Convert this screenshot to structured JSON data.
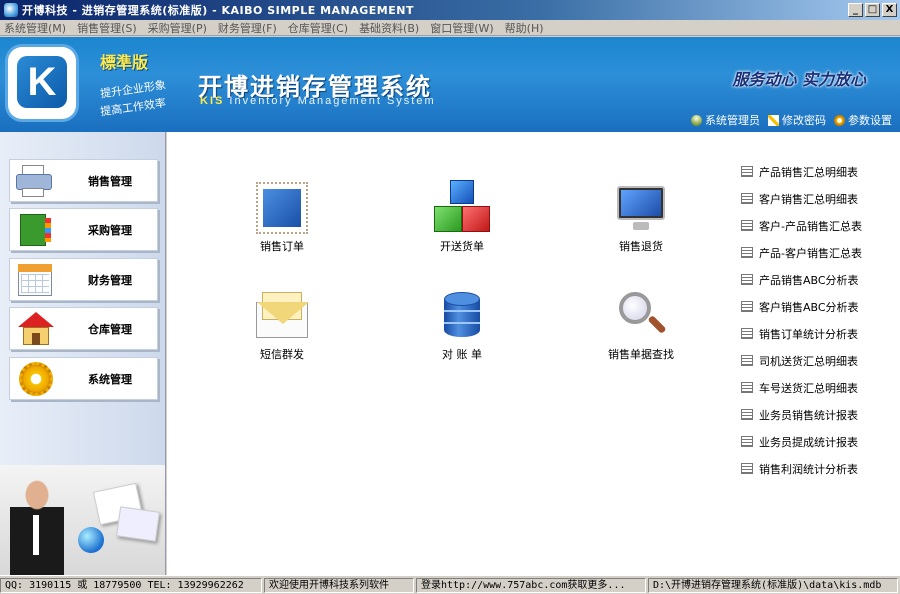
{
  "window": {
    "title": "开博科技 - 进销存管理系统(标准版) - KAIBO SIMPLE MANAGEMENT",
    "minimize": "_",
    "maximize": "□",
    "close": "X"
  },
  "menu": [
    "系统管理(M)",
    "销售管理(S)",
    "采购管理(P)",
    "财务管理(F)",
    "仓库管理(C)",
    "基础资料(B)",
    "窗口管理(W)",
    "帮助(H)"
  ],
  "banner": {
    "logo_letter": "K",
    "edition": "標準版",
    "slogan_line1": "提升企业形象",
    "slogan_line2": "提高工作效率",
    "title": "开博进销存管理系统",
    "subtitle_kis": "KIS",
    "subtitle_rest": " Inventory Management System",
    "motto": "服务动心 实力放心",
    "links": {
      "user": "系统管理员",
      "password": "修改密码",
      "settings": "参数设置"
    }
  },
  "sidebar": [
    {
      "label": "销售管理",
      "icon": "printer-icon"
    },
    {
      "label": "采购管理",
      "icon": "book-icon"
    },
    {
      "label": "财务管理",
      "icon": "calendar-icon"
    },
    {
      "label": "仓库管理",
      "icon": "house-icon"
    },
    {
      "label": "系统管理",
      "icon": "gear-icon"
    }
  ],
  "tiles": [
    {
      "label": "销售订单",
      "icon": "sales-order-icon"
    },
    {
      "label": "开送货单",
      "icon": "cubes-icon"
    },
    {
      "label": "销售退货",
      "icon": "monitor-icon"
    },
    {
      "label": "短信群发",
      "icon": "envelope-icon"
    },
    {
      "label": "对 账 单",
      "icon": "database-icon"
    },
    {
      "label": "销售单据查找",
      "icon": "magnifier-icon"
    }
  ],
  "reports": [
    "产品销售汇总明细表",
    "客户销售汇总明细表",
    "客户-产品销售汇总表",
    "产品-客户销售汇总表",
    "产品销售ABC分析表",
    "客户销售ABC分析表",
    "销售订单统计分析表",
    "司机送货汇总明细表",
    "车号送货汇总明细表",
    "业务员销售统计报表",
    "业务员提成统计报表",
    "销售利润统计分析表"
  ],
  "status": {
    "contact": "QQ: 3190115 或 18779500  TEL: 13929962262",
    "welcome": "欢迎使用开博科技系列软件",
    "website": "登录http://www.757abc.com获取更多...",
    "db_path": "D:\\开博进销存管理系统(标准版)\\data\\kis.mdb"
  }
}
